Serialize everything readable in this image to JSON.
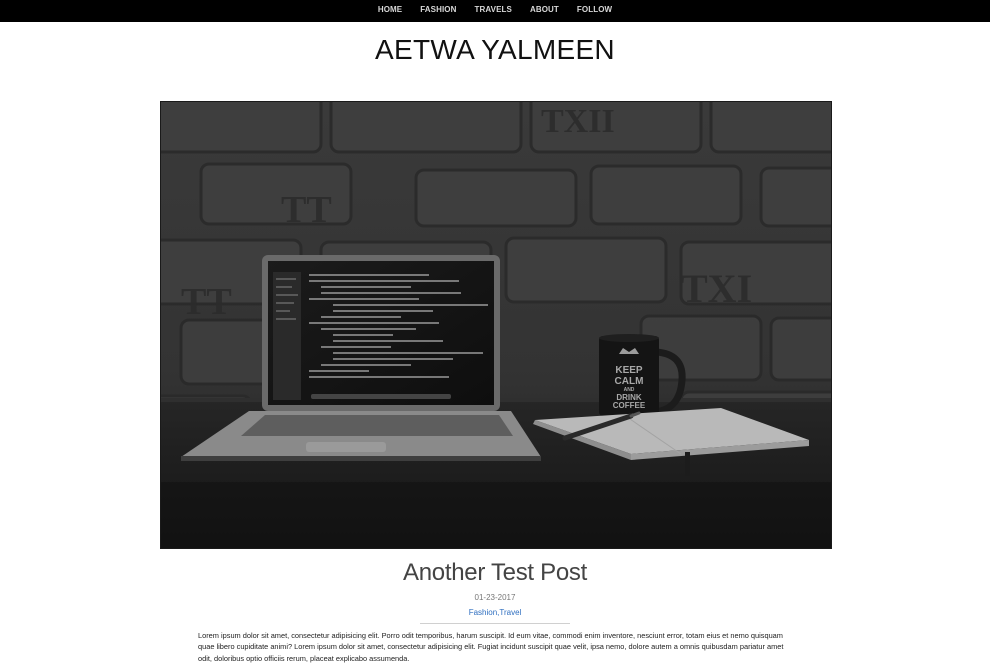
{
  "nav": {
    "items": [
      {
        "label": "HOME"
      },
      {
        "label": "FASHION"
      },
      {
        "label": "TRAVELS"
      },
      {
        "label": "ABOUT"
      },
      {
        "label": "FOLLOW"
      }
    ]
  },
  "site": {
    "title": "AETWA YALMEEN"
  },
  "hero": {
    "mug_lines": [
      "KEEP",
      "CALM",
      "AND",
      "DRINK",
      "COFFEE"
    ],
    "wall_text": [
      "TXII",
      "TT",
      "TXI"
    ]
  },
  "post": {
    "title": "Another Test Post",
    "date": "01-23-2017",
    "categories": "Fashion,Travel",
    "excerpt": "Lorem ipsum dolor sit amet, consectetur adipisicing elit. Porro odit temporibus, harum suscipit. Id eum vitae, commodi enim inventore, nesciunt error, totam eius et nemo quisquam quae libero cupiditate animi? Lorem ipsum dolor sit amet, consectetur adipisicing elit. Fugiat incidunt suscipit quae velit, ipsa nemo, dolore autem a omnis quibusdam pariatur amet odit, doloribus optio officiis rerum, placeat explicabo assumenda."
  },
  "colors": {
    "nav_bg": "#000000",
    "link": "#2f6fc0",
    "photo_tone": "#2b2b2b"
  }
}
